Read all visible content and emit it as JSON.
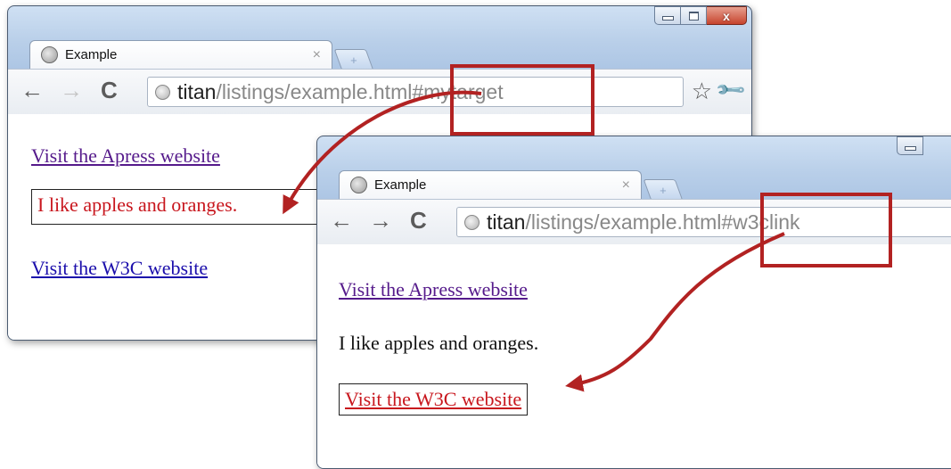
{
  "back_window": {
    "tab_title": "Example",
    "tab_close": "×",
    "new_tab": "+",
    "url_host": "titan",
    "url_path": "/listings/example.html#mytarget",
    "content": {
      "link_apress": "Visit the Apress website",
      "paragraph": "I like apples and oranges.",
      "link_w3c": "Visit the W3C website"
    }
  },
  "front_window": {
    "tab_title": "Example",
    "tab_close": "×",
    "new_tab": "+",
    "url_host": "titan",
    "url_path": "/listings/example.html#w3clink",
    "content": {
      "link_apress": "Visit the Apress website",
      "paragraph": "I like apples and oranges.",
      "link_w3c": "Visit the W3C website"
    }
  },
  "window_controls": {
    "close": "x"
  },
  "toolbar_glyphs": {
    "back": "←",
    "forward": "→",
    "reload": "C",
    "star": "☆",
    "wrench": "🔧"
  },
  "colors": {
    "highlight": "#c8161d",
    "visited_link": "#551a8b",
    "unvisited_link": "#1a0dab",
    "callout_box": "#b22222"
  },
  "icons": [
    "globe-icon",
    "back-arrow-icon",
    "forward-arrow-icon",
    "reload-icon",
    "star-icon",
    "wrench-icon",
    "close-icon",
    "minimize-icon",
    "maximize-icon"
  ]
}
